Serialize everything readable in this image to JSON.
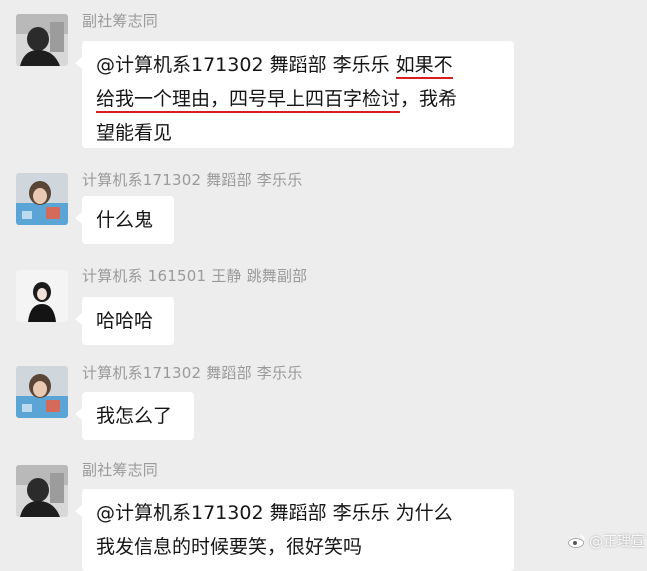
{
  "messages": [
    {
      "sender": "副社筹志同",
      "lines": [
        [
          {
            "text": "@计算机系171302  舞蹈部  李乐乐 ",
            "u": false
          },
          {
            "text": "如果不",
            "u": true
          }
        ],
        [
          {
            "text": "给我一个理由，四号早上四百字检讨",
            "u": true
          },
          {
            "text": "，我希",
            "u": false
          }
        ],
        [
          {
            "text": "望能看见",
            "u": false
          }
        ]
      ]
    },
    {
      "sender": "计算机系171302  舞蹈部  李乐乐",
      "lines": [
        [
          {
            "text": "什么鬼",
            "u": false
          }
        ]
      ]
    },
    {
      "sender": "计算机系 161501 王静 跳舞副部",
      "lines": [
        [
          {
            "text": "哈哈哈",
            "u": false
          }
        ]
      ]
    },
    {
      "sender": "计算机系171302  舞蹈部  李乐乐",
      "lines": [
        [
          {
            "text": "我怎么了",
            "u": false
          }
        ]
      ]
    },
    {
      "sender": "副社筹志同",
      "lines": [
        [
          {
            "text": "@计算机系171302  舞蹈部  李乐乐 为什么",
            "u": false
          }
        ],
        [
          {
            "text": "我发信息的时候要笑，很好笑吗",
            "u": false
          }
        ]
      ]
    }
  ],
  "watermark": {
    "text": "@正理宣"
  },
  "colors": {
    "background": "#ededed",
    "bubble": "#ffffff",
    "underline": "#d62020",
    "sender": "#9a9a9a"
  }
}
